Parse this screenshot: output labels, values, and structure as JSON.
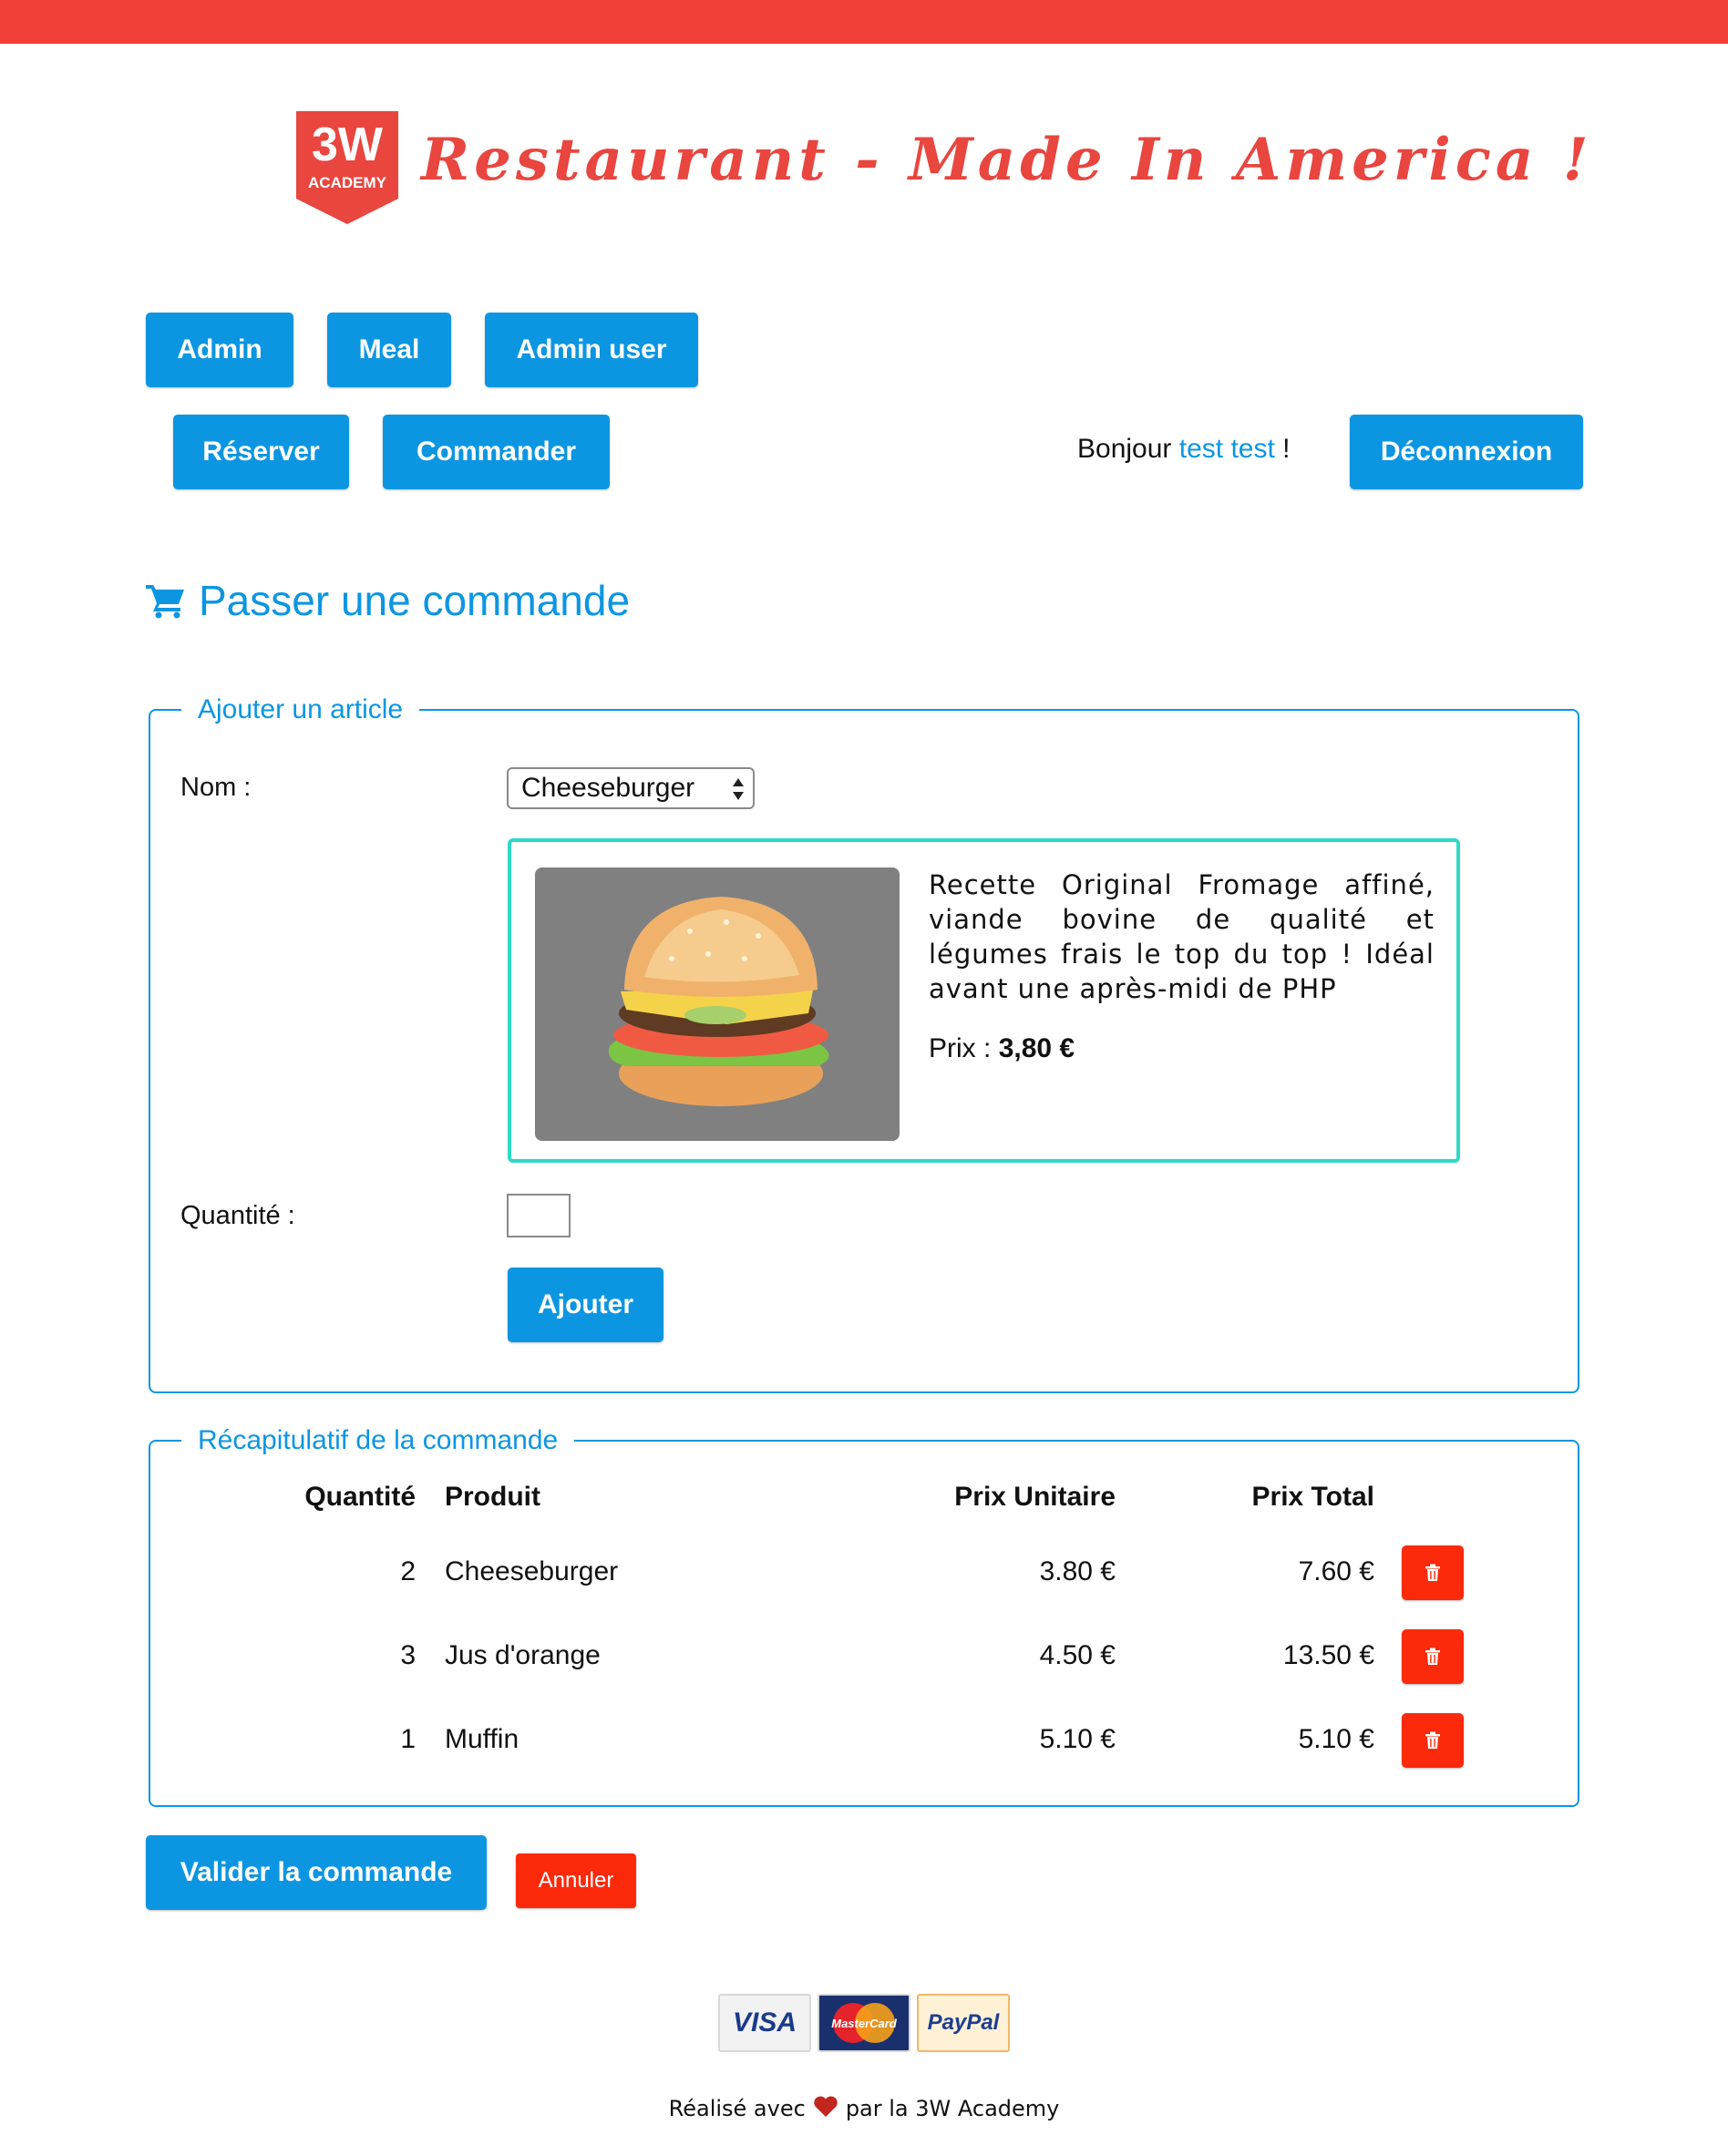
{
  "header": {
    "logo_text_top": "3W",
    "logo_text_bottom": "ACADEMY",
    "title": "Restaurant - Made In America !"
  },
  "nav": {
    "admin": "Admin",
    "meal": "Meal",
    "admin_user": "Admin user",
    "reserver": "Réserver",
    "commander": "Commander",
    "greeting_prefix": "Bonjour",
    "user_name": "test test",
    "greeting_suffix": "!",
    "logout": "Déconnexion"
  },
  "page": {
    "title": "Passer une commande"
  },
  "add_form": {
    "legend": "Ajouter un article",
    "name_label": "Nom :",
    "selected_meal": "Cheeseburger",
    "description": "Recette Original Fromage affiné, viande bovine de qualité et légumes frais le top du top ! Idéal avant une après-midi de PHP",
    "price_label": "Prix :",
    "price_value": "3,80 €",
    "quantity_label": "Quantité :",
    "quantity_value": "",
    "add_button": "Ajouter"
  },
  "summary": {
    "legend": "Récapitulatif de la commande",
    "headers": {
      "quantity": "Quantité",
      "product": "Produit",
      "unit_price": "Prix Unitaire",
      "total_price": "Prix Total"
    },
    "rows": [
      {
        "quantity": "2",
        "product": "Cheeseburger",
        "unit_price": "3.80 €",
        "total_price": "7.60 €"
      },
      {
        "quantity": "3",
        "product": "Jus d'orange",
        "unit_price": "4.50 €",
        "total_price": "13.50 €"
      },
      {
        "quantity": "1",
        "product": "Muffin",
        "unit_price": "5.10 €",
        "total_price": "5.10 €"
      }
    ],
    "validate_button": "Valider la commande",
    "cancel_button": "Annuler"
  },
  "footer": {
    "payment_visa": "VISA",
    "payment_mastercard": "MasterCard",
    "payment_paypal": "PayPal",
    "made_with": "Réalisé avec",
    "made_by": "par la 3W Academy"
  },
  "colors": {
    "brand_red": "#f13f37",
    "accent_blue": "#0c96e2",
    "danger": "#fc2a0a",
    "card_border": "#2ed9c6"
  },
  "icons": {
    "cart": "shopping-cart-icon",
    "trash": "trash-icon",
    "heart": "heart-icon"
  }
}
